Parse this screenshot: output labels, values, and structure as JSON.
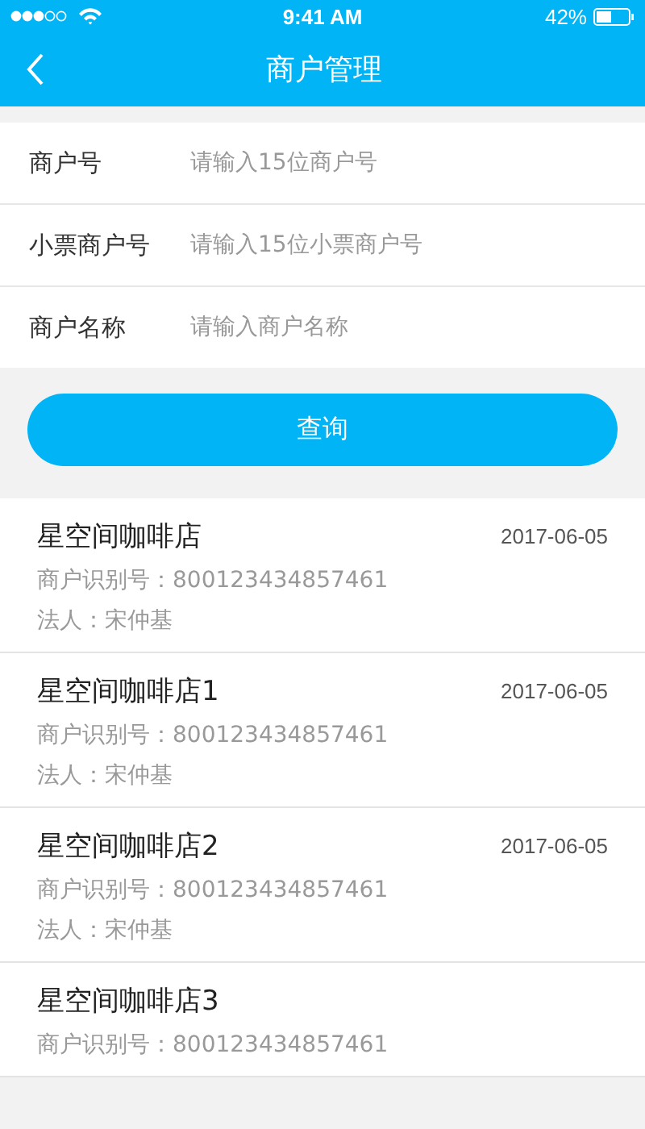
{
  "status_bar": {
    "time": "9:41 AM",
    "battery": "42%"
  },
  "nav": {
    "title": "商户管理"
  },
  "form": {
    "fields": [
      {
        "label": "商户号",
        "placeholder": "请输入15位商户号"
      },
      {
        "label": "小票商户号",
        "placeholder": "请输入15位小票商户号"
      },
      {
        "label": "商户名称",
        "placeholder": "请输入商户名称"
      }
    ],
    "button": "查询"
  },
  "merchants": [
    {
      "name": "星空间咖啡店",
      "date": "2017-06-05",
      "id": "商户识别号：800123434857461",
      "legal": "法人：宋仲基"
    },
    {
      "name": "星空间咖啡店1",
      "date": "2017-06-05",
      "id": "商户识别号：800123434857461",
      "legal": "法人：宋仲基"
    },
    {
      "name": "星空间咖啡店2",
      "date": "2017-06-05",
      "id": "商户识别号：800123434857461",
      "legal": "法人：宋仲基"
    },
    {
      "name": "星空间咖啡店3",
      "id": "商户识别号：800123434857461"
    }
  ]
}
